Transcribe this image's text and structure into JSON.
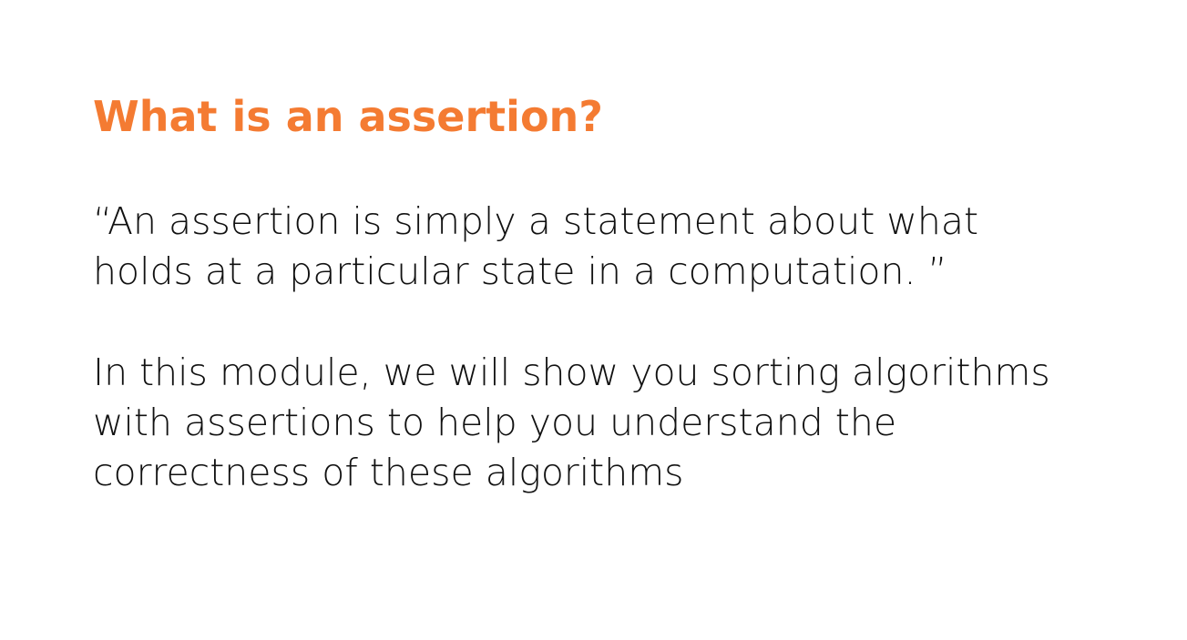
{
  "slide": {
    "title": "What is an assertion?",
    "quote_lines": [
      "“An assertion is simply a statement about what",
      "holds at a particular state in a computation. ”"
    ],
    "module_lines": [
      "In this module, we will show you sorting algorithms",
      "with assertions to help you understand the",
      "correctness of these algorithms"
    ]
  },
  "colors": {
    "title": "#f47b32",
    "text": "#111111",
    "background": "#ffffff"
  }
}
